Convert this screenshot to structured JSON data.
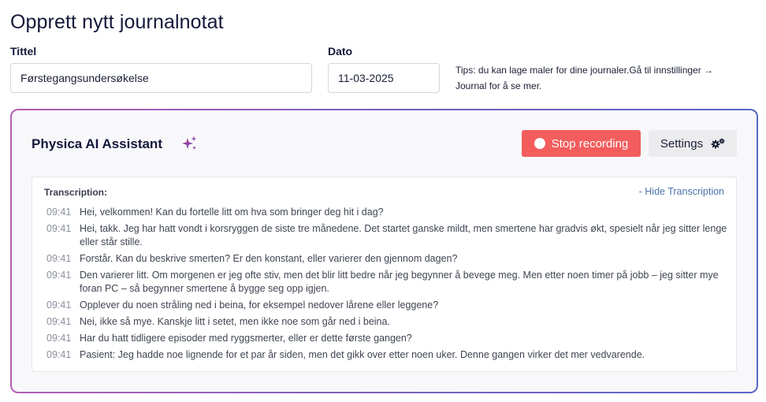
{
  "page": {
    "title": "Opprett nytt journalnotat"
  },
  "form": {
    "title_label": "Tittel",
    "title_value": "Førstegangsundersøkelse",
    "date_label": "Dato",
    "date_value": "11-03-2025",
    "tips": "Tips: du kan lage maler for dine journaler.Gå til innstillinger → Journal for å se mer."
  },
  "assistant": {
    "title": "Physica AI Assistant",
    "stop_label": "Stop recording",
    "settings_label": "Settings",
    "transcription_label": "Transcription:",
    "hide_label": "- Hide Transcription",
    "accent_stop": "#f35d5d",
    "lines": [
      {
        "time": "09:41",
        "text": "Hei, velkommen! Kan du fortelle litt om hva som bringer deg hit i dag?"
      },
      {
        "time": "09:41",
        "text": "Hei, takk. Jeg har hatt vondt i korsryggen de siste tre månedene. Det startet ganske mildt, men smertene har gradvis økt, spesielt når jeg sitter lenge eller står stille."
      },
      {
        "time": "09:41",
        "text": "Forstår. Kan du beskrive smerten? Er den konstant, eller varierer den gjennom dagen?"
      },
      {
        "time": "09:41",
        "text": "Den varierer litt. Om morgenen er jeg ofte stiv, men det blir litt bedre når jeg begynner å bevege meg. Men etter noen timer på jobb – jeg sitter mye foran PC – så begynner smertene å bygge seg opp igjen."
      },
      {
        "time": "09:41",
        "text": "Opplever du noen stråling ned i beina, for eksempel nedover lårene eller leggene?"
      },
      {
        "time": "09:41",
        "text": "Nei, ikke så mye. Kanskje litt i setet, men ikke noe som går ned i beina."
      },
      {
        "time": "09:41",
        "text": "Har du hatt tidligere episoder med ryggsmerter, eller er dette første gangen?"
      },
      {
        "time": "09:41",
        "text": "Pasient: Jeg hadde noe lignende for et par år siden, men det gikk over etter noen uker. Denne gangen virker det mer vedvarende."
      }
    ]
  }
}
